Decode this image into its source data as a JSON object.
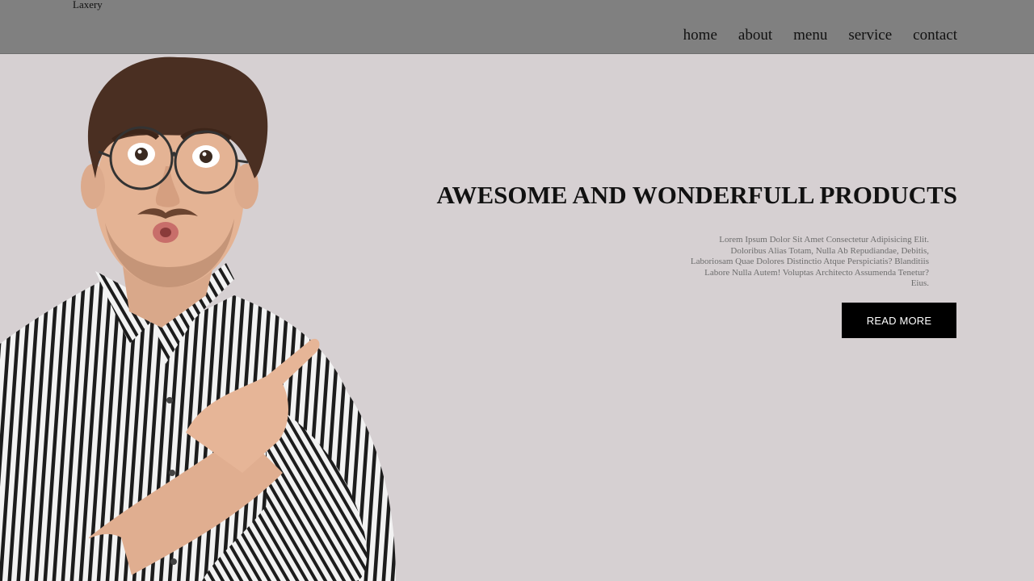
{
  "header": {
    "logo": "Laxery",
    "nav": [
      {
        "label": "home"
      },
      {
        "label": "about"
      },
      {
        "label": "menu"
      },
      {
        "label": "service"
      },
      {
        "label": "contact"
      }
    ]
  },
  "hero": {
    "title": "AWESOME AND WONDERFULL PRODUCTS",
    "description": "Lorem Ipsum Dolor Sit Amet Consectetur Adipisicing Elit. Doloribus Alias Totam, Nulla Ab Repudiandae, Debitis, Laboriosam Quae Dolores Distinctio Atque Perspiciatis? Blanditiis Labore Nulla Autem! Voluptas Architecto Assumenda Tenetur? Eius.",
    "button_label": "READ MORE"
  },
  "colors": {
    "header_bg": "#808080",
    "page_bg": "#d6d0d2",
    "button_bg": "#000000",
    "button_text": "#ffffff"
  }
}
